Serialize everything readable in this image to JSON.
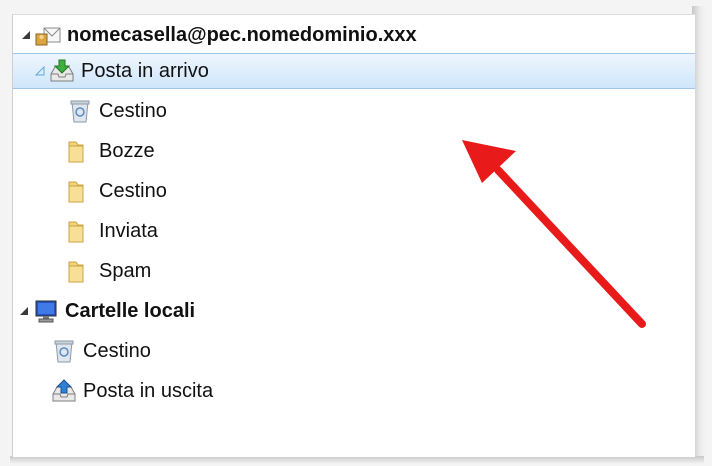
{
  "folder_tree": {
    "account": {
      "label": "nomecasella@pec.nomedominio.xxx",
      "icon": "mail-account-icon",
      "expanded": true
    },
    "account_folders": [
      {
        "label": "Posta in arrivo",
        "icon": "inbox-icon",
        "selected": true,
        "expanded": true
      },
      {
        "label": "Cestino",
        "icon": "trash-icon"
      },
      {
        "label": "Bozze",
        "icon": "folder-icon"
      },
      {
        "label": "Cestino",
        "icon": "folder-icon"
      },
      {
        "label": "Inviata",
        "icon": "folder-icon"
      },
      {
        "label": "Spam",
        "icon": "folder-icon"
      }
    ],
    "local": {
      "label": "Cartelle locali",
      "icon": "computer-icon",
      "expanded": true
    },
    "local_folders": [
      {
        "label": "Cestino",
        "icon": "trash-icon"
      },
      {
        "label": "Posta in uscita",
        "icon": "outbox-icon"
      }
    ]
  },
  "colors": {
    "selection_top": "#eef6fd",
    "selection_bottom": "#cfe6fb",
    "selection_border": "#9fc7ea",
    "annotation_arrow": "#e81a1a",
    "folder_yellow": "#f3d27a"
  }
}
